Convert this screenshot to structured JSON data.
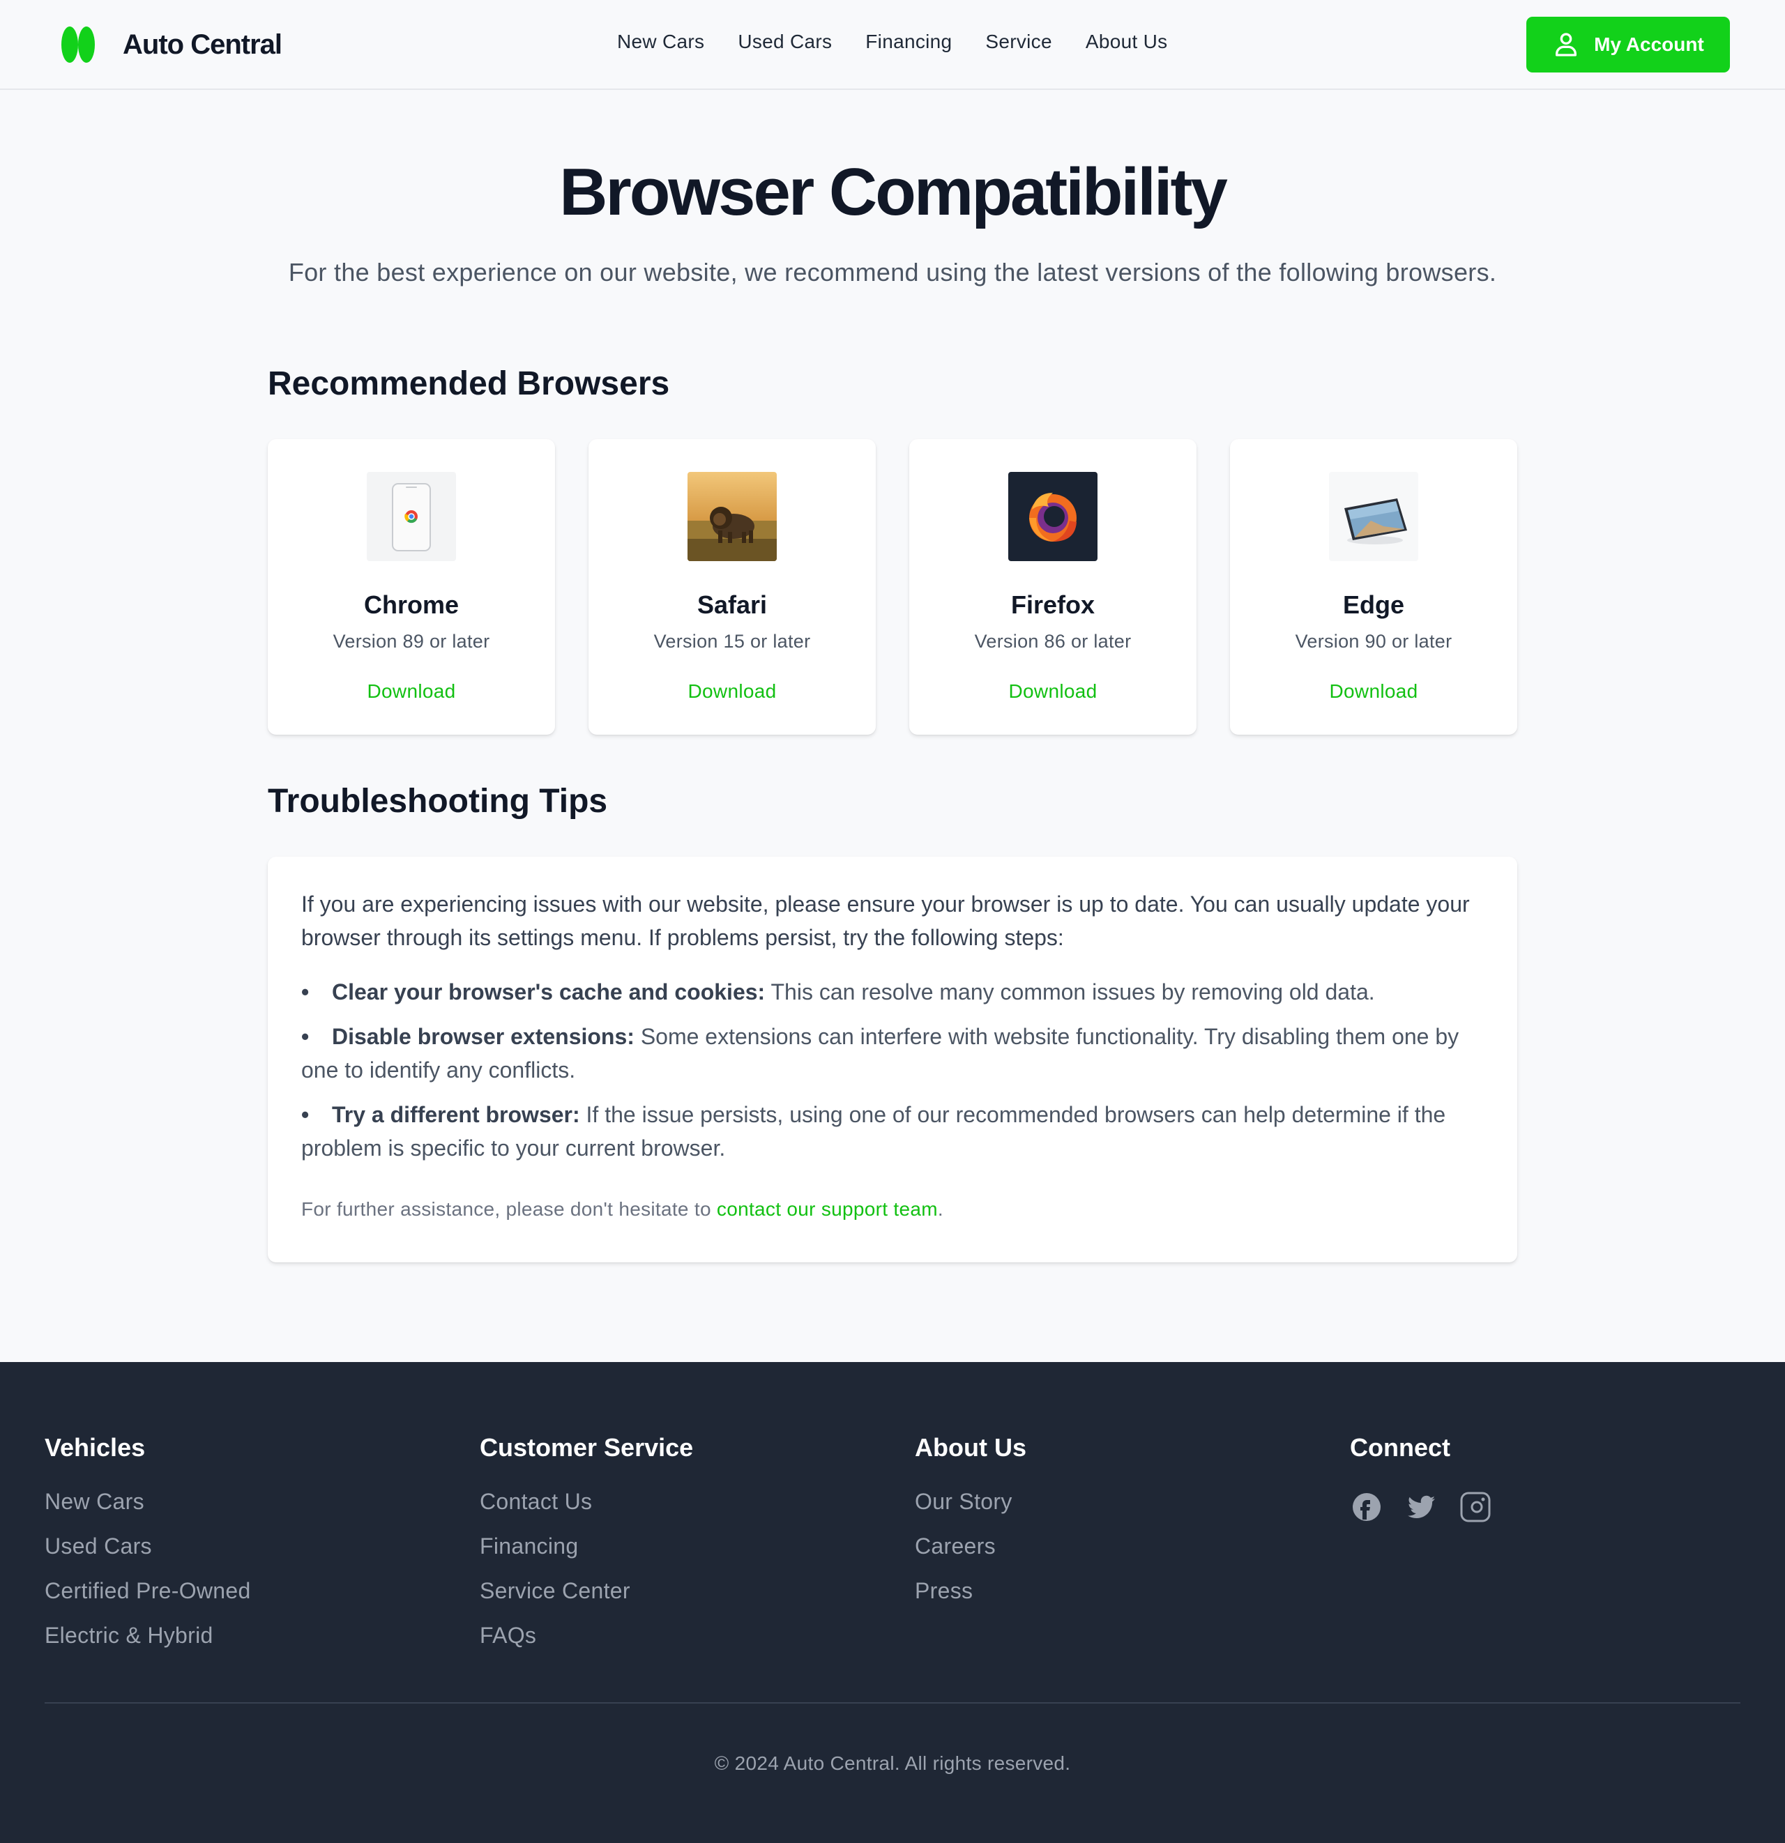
{
  "brand": {
    "name": "Auto Central",
    "accent": "#12d11a"
  },
  "nav": [
    {
      "label": "New Cars"
    },
    {
      "label": "Used Cars"
    },
    {
      "label": "Financing"
    },
    {
      "label": "Service"
    },
    {
      "label": "About Us"
    }
  ],
  "account": {
    "label": "My Account",
    "icon": "user-icon"
  },
  "hero": {
    "title": "Browser Compatibility",
    "subtitle": "For the best experience on our website, we recommend using the latest versions of the following browsers."
  },
  "recommended": {
    "title": "Recommended Browsers",
    "browsers": [
      {
        "name": "Chrome",
        "version": "Version 89 or later",
        "download": "Download",
        "image": "phone-with-chrome-logo"
      },
      {
        "name": "Safari",
        "version": "Version 15 or later",
        "download": "Download",
        "image": "lion-in-savanna"
      },
      {
        "name": "Firefox",
        "version": "Version 86 or later",
        "download": "Download",
        "image": "firefox-logo"
      },
      {
        "name": "Edge",
        "version": "Version 90 or later",
        "download": "Download",
        "image": "tablet-device"
      }
    ]
  },
  "troubleshooting": {
    "title": "Troubleshooting Tips",
    "intro": "If you are experiencing issues with our website, please ensure your browser is up to date. You can usually update your browser through its settings menu. If problems persist, try the following steps:",
    "tips": [
      {
        "bullet": "•",
        "title": "Clear your browser's cache and cookies:",
        "text": " This can resolve many common issues by removing old data."
      },
      {
        "bullet": "•",
        "title": "Disable browser extensions:",
        "text": " Some extensions can interfere with website functionality. Try disabling them one by one to identify any conflicts."
      },
      {
        "bullet": "•",
        "title": "Try a different browser:",
        "text": " If the issue persists, using one of our recommended browsers can help determine if the problem is specific to your current browser."
      }
    ],
    "assist_prefix": "For further assistance, please don't hesitate to ",
    "assist_link": "contact our support team",
    "assist_suffix": "."
  },
  "footer": {
    "columns": [
      {
        "title": "Vehicles",
        "links": [
          "New Cars",
          "Used Cars",
          "Certified Pre-Owned",
          "Electric & Hybrid"
        ]
      },
      {
        "title": "Customer Service",
        "links": [
          "Contact Us",
          "Financing",
          "Service Center",
          "FAQs"
        ]
      },
      {
        "title": "About Us",
        "links": [
          "Our Story",
          "Careers",
          "Press"
        ]
      }
    ],
    "connect": {
      "title": "Connect",
      "icons": [
        "facebook-icon",
        "twitter-icon",
        "instagram-icon"
      ]
    },
    "copyright": "© 2024 Auto Central. All rights reserved."
  }
}
